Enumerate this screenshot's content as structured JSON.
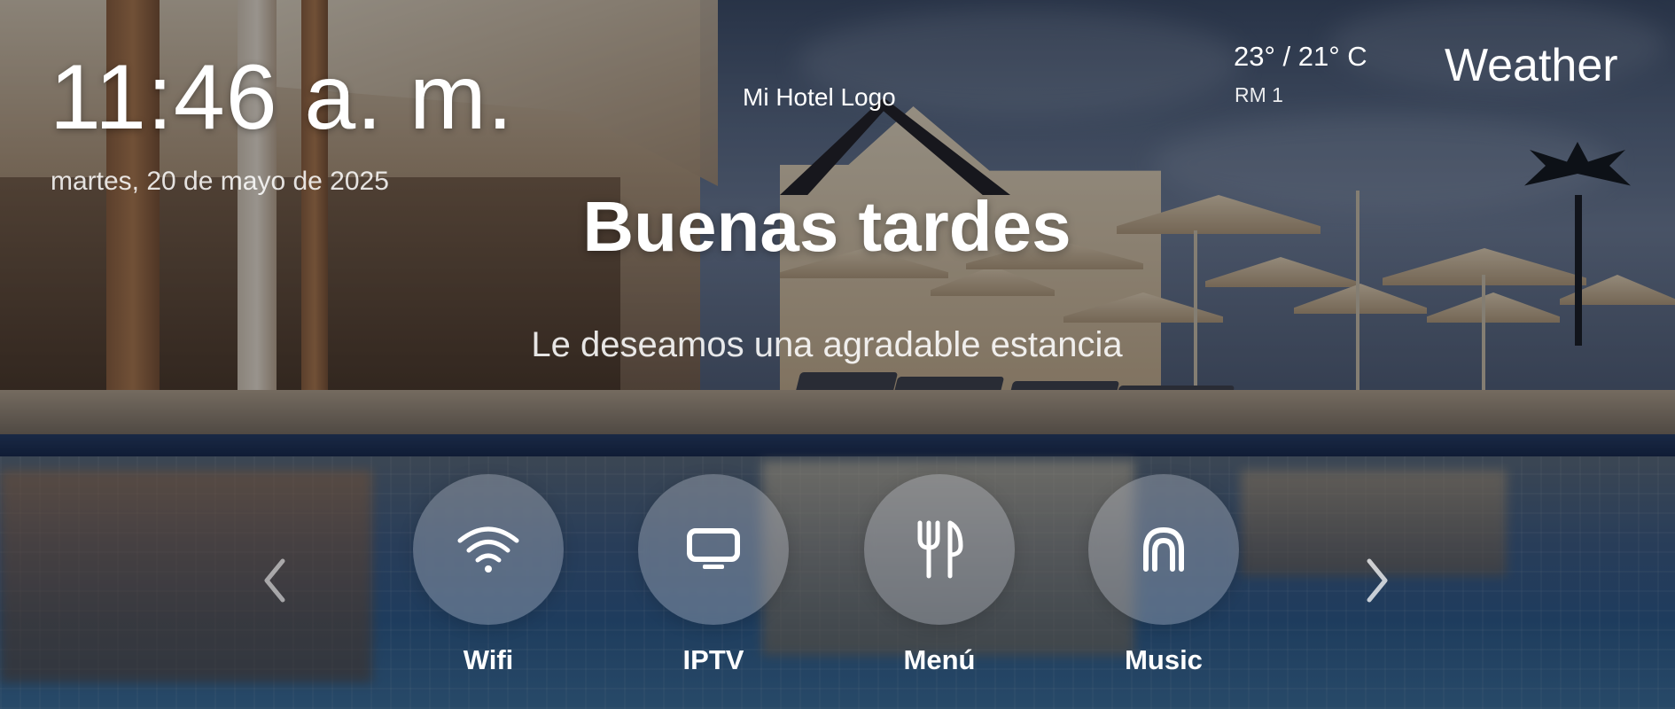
{
  "header": {
    "time": "11:46 a. m.",
    "date": "martes, 20 de mayo de 2025",
    "logo_text": "Mi Hotel Logo",
    "temperature": "23° / 21° C",
    "room": "RM 1",
    "weather_label": "Weather"
  },
  "hero": {
    "greeting": "Buenas tardes",
    "subtitle": "Le deseamos una agradable estancia"
  },
  "menu": {
    "items": [
      {
        "label": "Wifi",
        "icon": "wifi-icon"
      },
      {
        "label": "IPTV",
        "icon": "tv-icon"
      },
      {
        "label": "Menú",
        "icon": "cutlery-icon"
      },
      {
        "label": "Music",
        "icon": "music-icon"
      }
    ],
    "prev_icon": "chevron-left-icon",
    "next_icon": "chevron-right-icon"
  }
}
